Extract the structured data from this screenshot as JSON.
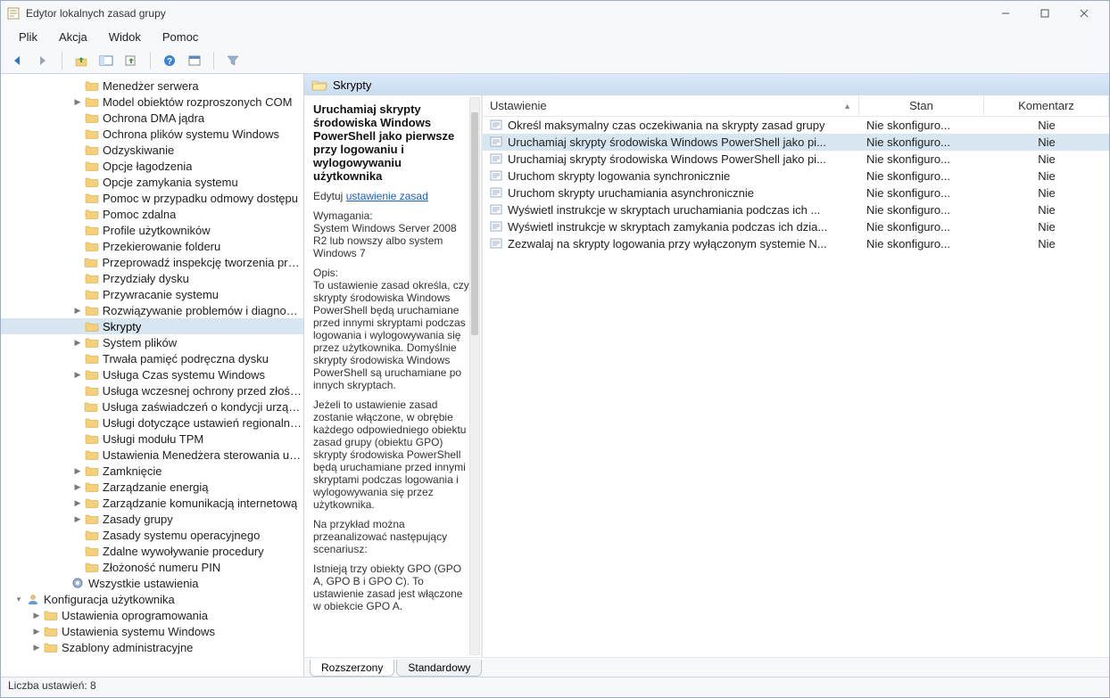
{
  "window_title": "Edytor lokalnych zasad grupy",
  "menu": {
    "file": "Plik",
    "action": "Akcja",
    "view": "Widok",
    "help": "Pomoc"
  },
  "tree": {
    "items": [
      {
        "label": "Menedżer serwera",
        "indent": 80,
        "arrow": ""
      },
      {
        "label": "Model obiektów rozproszonych COM",
        "indent": 80,
        "arrow": ">"
      },
      {
        "label": "Ochrona DMA jądra",
        "indent": 80,
        "arrow": ""
      },
      {
        "label": "Ochrona plików systemu Windows",
        "indent": 80,
        "arrow": ""
      },
      {
        "label": "Odzyskiwanie",
        "indent": 80,
        "arrow": ""
      },
      {
        "label": "Opcje łagodzenia",
        "indent": 80,
        "arrow": ""
      },
      {
        "label": "Opcje zamykania systemu",
        "indent": 80,
        "arrow": ""
      },
      {
        "label": "Pomoc w przypadku odmowy dostępu",
        "indent": 80,
        "arrow": ""
      },
      {
        "label": "Pomoc zdalna",
        "indent": 80,
        "arrow": ""
      },
      {
        "label": "Profile użytkowników",
        "indent": 80,
        "arrow": ""
      },
      {
        "label": "Przekierowanie folderu",
        "indent": 80,
        "arrow": ""
      },
      {
        "label": "Przeprowadź inspekcję tworzenia proces",
        "indent": 80,
        "arrow": ""
      },
      {
        "label": "Przydziały dysku",
        "indent": 80,
        "arrow": ""
      },
      {
        "label": "Przywracanie systemu",
        "indent": 80,
        "arrow": ""
      },
      {
        "label": "Rozwiązywanie problemów i diagnostyk",
        "indent": 80,
        "arrow": ">"
      },
      {
        "label": "Skrypty",
        "indent": 80,
        "arrow": "",
        "selected": true
      },
      {
        "label": "System plików",
        "indent": 80,
        "arrow": ">"
      },
      {
        "label": "Trwała pamięć podręczna dysku",
        "indent": 80,
        "arrow": ""
      },
      {
        "label": "Usługa Czas systemu Windows",
        "indent": 80,
        "arrow": ">"
      },
      {
        "label": "Usługa wczesnej ochrony przed złośliwy",
        "indent": 80,
        "arrow": ""
      },
      {
        "label": "Usługa zaświadczeń o kondycji urządzeń",
        "indent": 80,
        "arrow": ""
      },
      {
        "label": "Usługi dotyczące ustawień regionalnych",
        "indent": 80,
        "arrow": ""
      },
      {
        "label": "Usługi modułu TPM",
        "indent": 80,
        "arrow": ""
      },
      {
        "label": "Ustawienia Menedżera sterowania usług",
        "indent": 80,
        "arrow": ""
      },
      {
        "label": "Zamknięcie",
        "indent": 80,
        "arrow": ">"
      },
      {
        "label": "Zarządzanie energią",
        "indent": 80,
        "arrow": ">"
      },
      {
        "label": "Zarządzanie komunikacją internetową",
        "indent": 80,
        "arrow": ">"
      },
      {
        "label": "Zasady grupy",
        "indent": 80,
        "arrow": ">"
      },
      {
        "label": "Zasady systemu operacyjnego",
        "indent": 80,
        "arrow": ""
      },
      {
        "label": "Zdalne wywoływanie procedury",
        "indent": 80,
        "arrow": ""
      },
      {
        "label": "Złożoność numeru PIN",
        "indent": 80,
        "arrow": ""
      },
      {
        "label": "Wszystkie ustawienia",
        "indent": 64,
        "arrow": "",
        "special": "settings"
      },
      {
        "label": "Konfiguracja użytkownika",
        "indent": 14,
        "arrow": "v",
        "special": "user"
      },
      {
        "label": "Ustawienia oprogramowania",
        "indent": 34,
        "arrow": ">"
      },
      {
        "label": "Ustawienia systemu Windows",
        "indent": 34,
        "arrow": ">"
      },
      {
        "label": "Szablony administracyjne",
        "indent": 34,
        "arrow": ">"
      }
    ]
  },
  "crumb": {
    "label": "Skrypty"
  },
  "detail": {
    "title": "Uruchamiaj skrypty środowiska Windows PowerShell jako pierwsze przy logowaniu i wylogowywaniu użytkownika",
    "edit_prefix": "Edytuj ",
    "edit_link": "ustawienie zasad",
    "req_label": "Wymagania:",
    "req_text": "System Windows Server 2008 R2 lub nowszy albo system Windows 7",
    "desc_label": "Opis:",
    "desc_p1": "To ustawienie zasad określa, czy skrypty środowiska Windows PowerShell będą uruchamiane przed innymi skryptami podczas logowania i wylogowywania się przez użytkownika. Domyślnie skrypty środowiska Windows PowerShell są uruchamiane po innych skryptach.",
    "desc_p2": "Jeżeli to ustawienie zasad zostanie włączone, w obrębie każdego odpowiedniego obiektu zasad grupy (obiektu GPO) skrypty środowiska PowerShell będą uruchamiane przed innymi skryptami podczas logowania i wylogowywania się przez użytkownika.",
    "desc_p3": "Na przykład można przeanalizować następujący scenariusz:",
    "desc_p4": "Istnieją trzy obiekty GPO (GPO A, GPO B i GPO C). To ustawienie zasad jest włączone w obiekcie GPO A."
  },
  "list": {
    "headers": {
      "setting": "Ustawienie",
      "state": "Stan",
      "comment": "Komentarz"
    },
    "rows": [
      {
        "setting": "Określ maksymalny czas oczekiwania na skrypty zasad grupy",
        "state": "Nie skonfiguro...",
        "comment": "Nie"
      },
      {
        "setting": "Uruchamiaj skrypty środowiska Windows PowerShell jako pi...",
        "state": "Nie skonfiguro...",
        "comment": "Nie",
        "selected": true
      },
      {
        "setting": "Uruchamiaj skrypty środowiska Windows PowerShell jako pi...",
        "state": "Nie skonfiguro...",
        "comment": "Nie"
      },
      {
        "setting": "Uruchom skrypty logowania synchronicznie",
        "state": "Nie skonfiguro...",
        "comment": "Nie"
      },
      {
        "setting": "Uruchom skrypty uruchamiania asynchronicznie",
        "state": "Nie skonfiguro...",
        "comment": "Nie"
      },
      {
        "setting": "Wyświetl instrukcje w skryptach uruchamiania podczas ich ...",
        "state": "Nie skonfiguro...",
        "comment": "Nie"
      },
      {
        "setting": "Wyświetl instrukcje w skryptach zamykania podczas ich dzia...",
        "state": "Nie skonfiguro...",
        "comment": "Nie"
      },
      {
        "setting": "Zezwalaj na skrypty logowania przy wyłączonym systemie N...",
        "state": "Nie skonfiguro...",
        "comment": "Nie"
      }
    ]
  },
  "tabs": {
    "extended": "Rozszerzony",
    "standard": "Standardowy"
  },
  "status": "Liczba ustawień: 8"
}
